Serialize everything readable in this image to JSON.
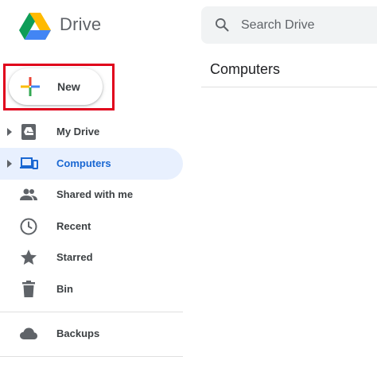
{
  "app": {
    "title": "Drive"
  },
  "search": {
    "placeholder": "Search Drive"
  },
  "content": {
    "title": "Computers"
  },
  "new_button": {
    "label": "New"
  },
  "sidebar": {
    "items": [
      {
        "label": "My Drive",
        "icon": "my-drive-icon",
        "expandable": true,
        "active": false
      },
      {
        "label": "Computers",
        "icon": "computers-icon",
        "expandable": true,
        "active": true
      },
      {
        "label": "Shared with me",
        "icon": "shared-icon",
        "expandable": false,
        "active": false
      },
      {
        "label": "Recent",
        "icon": "clock-icon",
        "expandable": false,
        "active": false
      },
      {
        "label": "Starred",
        "icon": "star-icon",
        "expandable": false,
        "active": false
      },
      {
        "label": "Bin",
        "icon": "trash-icon",
        "expandable": false,
        "active": false
      },
      {
        "label": "Backups",
        "icon": "cloud-icon",
        "expandable": false,
        "active": false
      }
    ]
  },
  "colors": {
    "accent": "#1967d2",
    "active_bg": "#e8f0fe",
    "highlight_frame": "#e0001b",
    "icon_gray": "#5f6368"
  }
}
